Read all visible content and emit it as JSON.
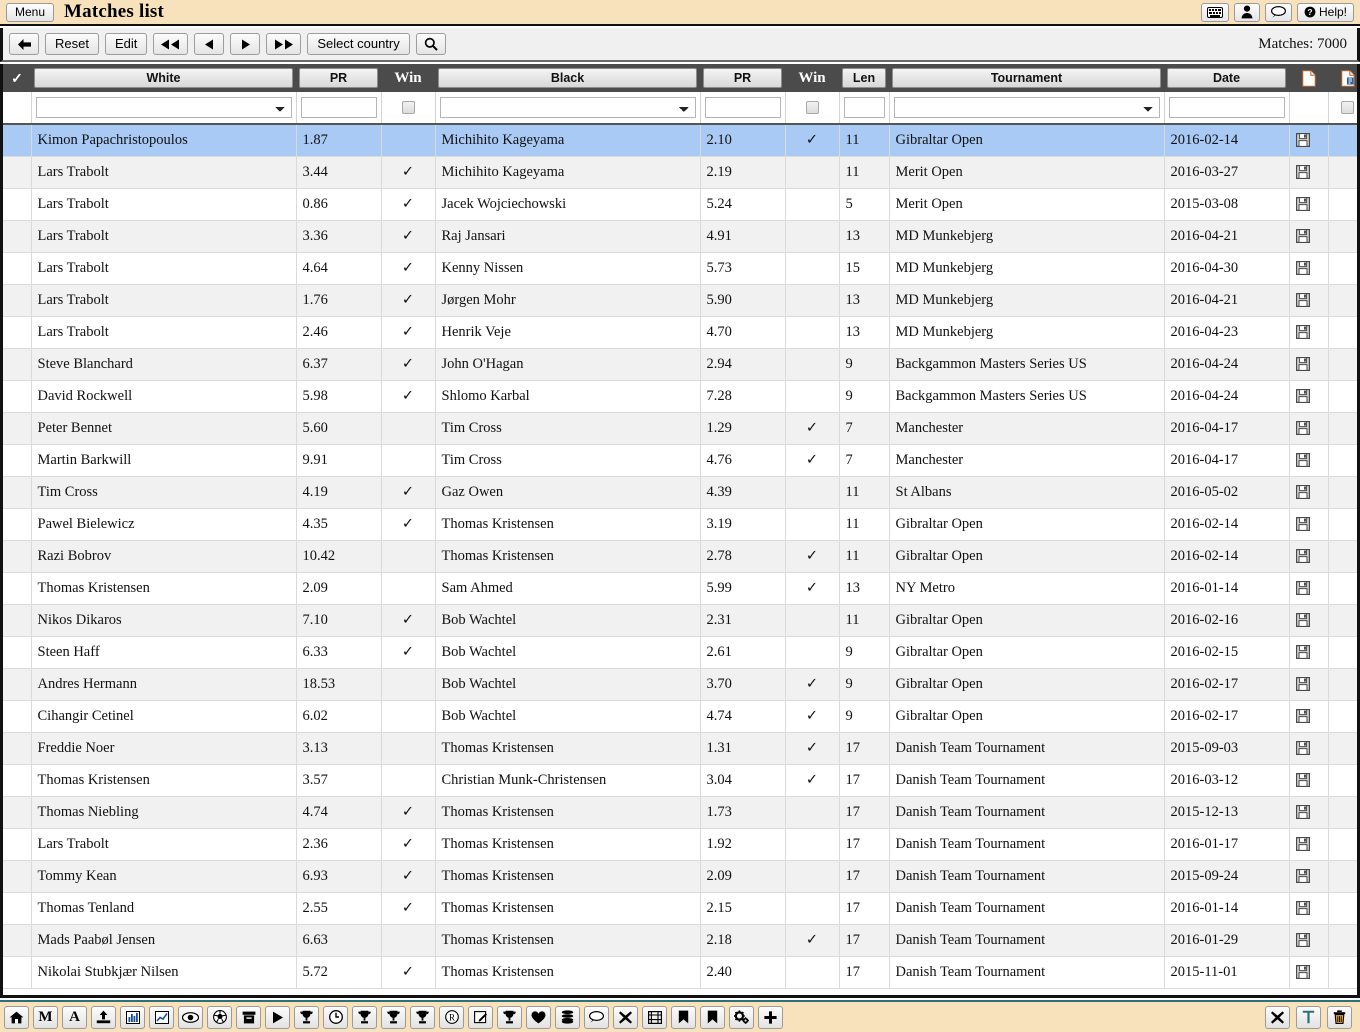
{
  "titlebar": {
    "menu_label": "Menu",
    "app_title": "Matches list",
    "buttons": [
      {
        "name": "keyboard-icon",
        "glyph": "⌨"
      },
      {
        "name": "user-icon",
        "glyph": "♟"
      },
      {
        "name": "comment-icon",
        "glyph": "☺"
      },
      {
        "name": "help-button",
        "label": "Help!"
      }
    ]
  },
  "actionbar": {
    "back_label": "←",
    "reset_label": "Reset",
    "edit_label": "Edit",
    "first_label": "◀◀",
    "prev_label": "◀",
    "next_label": "▶",
    "last_label": "▶▶",
    "select_country_label": "Select country",
    "search_label": "⚲",
    "match_count": "Matches: 7000"
  },
  "table": {
    "headers": {
      "check": "✓",
      "white": "White",
      "pr1": "PR",
      "win1": "Win",
      "black": "Black",
      "pr2": "PR",
      "win2": "Win",
      "len": "Len",
      "tournament": "Tournament",
      "date": "Date",
      "doc1": "page-icon",
      "doc2": "page-export-icon"
    },
    "filters": {
      "white_value": "",
      "pr1_value": "",
      "win1_checked": false,
      "black_value": "",
      "pr2_value": "",
      "win2_checked": false,
      "len_value": "",
      "tournament_value": "",
      "date_value": "",
      "last_checked": false
    },
    "rows": [
      {
        "white": "Kimon Papachristopoulos",
        "pr1": "1.87",
        "win1": "",
        "black": "Michihito Kageyama",
        "pr2": "2.10",
        "win2": "✓",
        "len": "11",
        "tournament": "Gibraltar Open",
        "date": "2016-02-14",
        "selected": true
      },
      {
        "white": "Lars Trabolt",
        "pr1": "3.44",
        "win1": "✓",
        "black": "Michihito Kageyama",
        "pr2": "2.19",
        "win2": "",
        "len": "11",
        "tournament": "Merit Open",
        "date": "2016-03-27"
      },
      {
        "white": "Lars Trabolt",
        "pr1": "0.86",
        "win1": "✓",
        "black": "Jacek Wojciechowski",
        "pr2": "5.24",
        "win2": "",
        "len": "5",
        "tournament": "Merit Open",
        "date": "2015-03-08"
      },
      {
        "white": "Lars Trabolt",
        "pr1": "3.36",
        "win1": "✓",
        "black": "Raj Jansari",
        "pr2": "4.91",
        "win2": "",
        "len": "13",
        "tournament": "MD Munkebjerg",
        "date": "2016-04-21"
      },
      {
        "white": "Lars Trabolt",
        "pr1": "4.64",
        "win1": "✓",
        "black": "Kenny Nissen",
        "pr2": "5.73",
        "win2": "",
        "len": "15",
        "tournament": "MD Munkebjerg",
        "date": "2016-04-30"
      },
      {
        "white": "Lars Trabolt",
        "pr1": "1.76",
        "win1": "✓",
        "black": "Jørgen Mohr",
        "pr2": "5.90",
        "win2": "",
        "len": "13",
        "tournament": "MD Munkebjerg",
        "date": "2016-04-21"
      },
      {
        "white": "Lars Trabolt",
        "pr1": "2.46",
        "win1": "✓",
        "black": "Henrik Veje",
        "pr2": "4.70",
        "win2": "",
        "len": "13",
        "tournament": "MD Munkebjerg",
        "date": "2016-04-23"
      },
      {
        "white": "Steve Blanchard",
        "pr1": "6.37",
        "win1": "✓",
        "black": "John O'Hagan",
        "pr2": "2.94",
        "win2": "",
        "len": "9",
        "tournament": "Backgammon Masters Series US",
        "date": "2016-04-24"
      },
      {
        "white": "David Rockwell",
        "pr1": "5.98",
        "win1": "✓",
        "black": "Shlomo Karbal",
        "pr2": "7.28",
        "win2": "",
        "len": "9",
        "tournament": "Backgammon Masters Series US",
        "date": "2016-04-24"
      },
      {
        "white": "Peter Bennet",
        "pr1": "5.60",
        "win1": "",
        "black": "Tim Cross",
        "pr2": "1.29",
        "win2": "✓",
        "len": "7",
        "tournament": "Manchester",
        "date": "2016-04-17"
      },
      {
        "white": "Martin Barkwill",
        "pr1": "9.91",
        "win1": "",
        "black": "Tim Cross",
        "pr2": "4.76",
        "win2": "✓",
        "len": "7",
        "tournament": "Manchester",
        "date": "2016-04-17"
      },
      {
        "white": "Tim Cross",
        "pr1": "4.19",
        "win1": "✓",
        "black": "Gaz Owen",
        "pr2": "4.39",
        "win2": "",
        "len": "11",
        "tournament": "St Albans",
        "date": "2016-05-02"
      },
      {
        "white": "Pawel Bielewicz",
        "pr1": "4.35",
        "win1": "✓",
        "black": "Thomas Kristensen",
        "pr2": "3.19",
        "win2": "",
        "len": "11",
        "tournament": "Gibraltar Open",
        "date": "2016-02-14"
      },
      {
        "white": "Razi Bobrov",
        "pr1": "10.42",
        "win1": "",
        "black": "Thomas Kristensen",
        "pr2": "2.78",
        "win2": "✓",
        "len": "11",
        "tournament": "Gibraltar Open",
        "date": "2016-02-14"
      },
      {
        "white": "Thomas Kristensen",
        "pr1": "2.09",
        "win1": "",
        "black": "Sam Ahmed",
        "pr2": "5.99",
        "win2": "✓",
        "len": "13",
        "tournament": "NY Metro",
        "date": "2016-01-14"
      },
      {
        "white": "Nikos Dikaros",
        "pr1": "7.10",
        "win1": "✓",
        "black": "Bob Wachtel",
        "pr2": "2.31",
        "win2": "",
        "len": "11",
        "tournament": "Gibraltar Open",
        "date": "2016-02-16"
      },
      {
        "white": "Steen Haff",
        "pr1": "6.33",
        "win1": "✓",
        "black": "Bob Wachtel",
        "pr2": "2.61",
        "win2": "",
        "len": "9",
        "tournament": "Gibraltar Open",
        "date": "2016-02-15"
      },
      {
        "white": "Andres Hermann",
        "pr1": "18.53",
        "win1": "",
        "black": "Bob Wachtel",
        "pr2": "3.70",
        "win2": "✓",
        "len": "9",
        "tournament": "Gibraltar Open",
        "date": "2016-02-17"
      },
      {
        "white": "Cihangir Cetinel",
        "pr1": "6.02",
        "win1": "",
        "black": "Bob Wachtel",
        "pr2": "4.74",
        "win2": "✓",
        "len": "9",
        "tournament": "Gibraltar Open",
        "date": "2016-02-17"
      },
      {
        "white": "Freddie Noer",
        "pr1": "3.13",
        "win1": "",
        "black": "Thomas Kristensen",
        "pr2": "1.31",
        "win2": "✓",
        "len": "17",
        "tournament": "Danish Team Tournament",
        "date": "2015-09-03"
      },
      {
        "white": "Thomas Kristensen",
        "pr1": "3.57",
        "win1": "",
        "black": "Christian Munk-Christensen",
        "pr2": "3.04",
        "win2": "✓",
        "len": "17",
        "tournament": "Danish Team Tournament",
        "date": "2016-03-12"
      },
      {
        "white": "Thomas Niebling",
        "pr1": "4.74",
        "win1": "✓",
        "black": "Thomas Kristensen",
        "pr2": "1.73",
        "win2": "",
        "len": "17",
        "tournament": "Danish Team Tournament",
        "date": "2015-12-13"
      },
      {
        "white": "Lars Trabolt",
        "pr1": "2.36",
        "win1": "✓",
        "black": "Thomas Kristensen",
        "pr2": "1.92",
        "win2": "",
        "len": "17",
        "tournament": "Danish Team Tournament",
        "date": "2016-01-17"
      },
      {
        "white": "Tommy Kean",
        "pr1": "6.93",
        "win1": "✓",
        "black": "Thomas Kristensen",
        "pr2": "2.09",
        "win2": "",
        "len": "17",
        "tournament": "Danish Team Tournament",
        "date": "2015-09-24"
      },
      {
        "white": "Thomas Tenland",
        "pr1": "2.55",
        "win1": "✓",
        "black": "Thomas Kristensen",
        "pr2": "2.15",
        "win2": "",
        "len": "17",
        "tournament": "Danish Team Tournament",
        "date": "2016-01-14"
      },
      {
        "white": "Mads Paabøl Jensen",
        "pr1": "6.63",
        "win1": "",
        "black": "Thomas Kristensen",
        "pr2": "2.18",
        "win2": "✓",
        "len": "17",
        "tournament": "Danish Team Tournament",
        "date": "2016-01-29"
      },
      {
        "white": "Nikolai Stubkjær Nilsen",
        "pr1": "5.72",
        "win1": "✓",
        "black": "Thomas Kristensen",
        "pr2": "2.40",
        "win2": "",
        "len": "17",
        "tournament": "Danish Team Tournament",
        "date": "2015-11-01"
      }
    ],
    "row_save_icon": "floppy-disk-icon"
  },
  "bottombar": {
    "left_buttons": [
      {
        "name": "home-icon",
        "glyph": "⌂"
      },
      {
        "name": "letter-m-icon",
        "glyph": "M"
      },
      {
        "name": "letter-a-icon",
        "glyph": "A"
      },
      {
        "name": "upload-icon",
        "glyph": "⇧"
      },
      {
        "name": "bar-chart-icon",
        "glyph": "▐"
      },
      {
        "name": "line-chart-icon",
        "glyph": "↗"
      },
      {
        "name": "eye-icon",
        "glyph": "◉"
      },
      {
        "name": "soccer-ball-icon",
        "glyph": "⚽"
      },
      {
        "name": "archive-box-icon",
        "glyph": "⬛"
      },
      {
        "name": "play-icon",
        "glyph": "▶"
      },
      {
        "name": "trophy-icon",
        "glyph": "♚"
      },
      {
        "name": "clock-icon",
        "glyph": "◴"
      },
      {
        "name": "trophy-icon-2",
        "glyph": "♚"
      },
      {
        "name": "trophy-icon-3",
        "glyph": "♚"
      },
      {
        "name": "trophy-icon-4",
        "glyph": "♚"
      },
      {
        "name": "registered-icon",
        "glyph": "®"
      },
      {
        "name": "edit-note-icon",
        "glyph": "✎"
      },
      {
        "name": "trophy-icon-5",
        "glyph": "♚"
      },
      {
        "name": "heart-icon",
        "glyph": "♥"
      },
      {
        "name": "database-icon",
        "glyph": "≡"
      },
      {
        "name": "chat-icon",
        "glyph": "☺"
      },
      {
        "name": "close-x-icon",
        "glyph": "✖"
      },
      {
        "name": "film-icon",
        "glyph": "▦"
      },
      {
        "name": "bookmark-icon",
        "glyph": "⚑"
      },
      {
        "name": "bookmark-icon-2",
        "glyph": "⚑"
      },
      {
        "name": "settings-gears-icon",
        "glyph": "⚙"
      },
      {
        "name": "plus-icon",
        "glyph": "➕"
      }
    ],
    "right_buttons": [
      {
        "name": "close-x-icon",
        "glyph": "✖"
      },
      {
        "name": "text-tool-icon",
        "glyph": "T"
      },
      {
        "name": "trash-icon",
        "glyph": "Ὕ1"
      }
    ]
  },
  "colors": {
    "title_bg": "#f7e2bc",
    "header_bg": "#4b4b4b",
    "selected_row": "#a8caf4",
    "alt_row": "#f1f1f1",
    "bottom_accent": "#2f6f78"
  }
}
